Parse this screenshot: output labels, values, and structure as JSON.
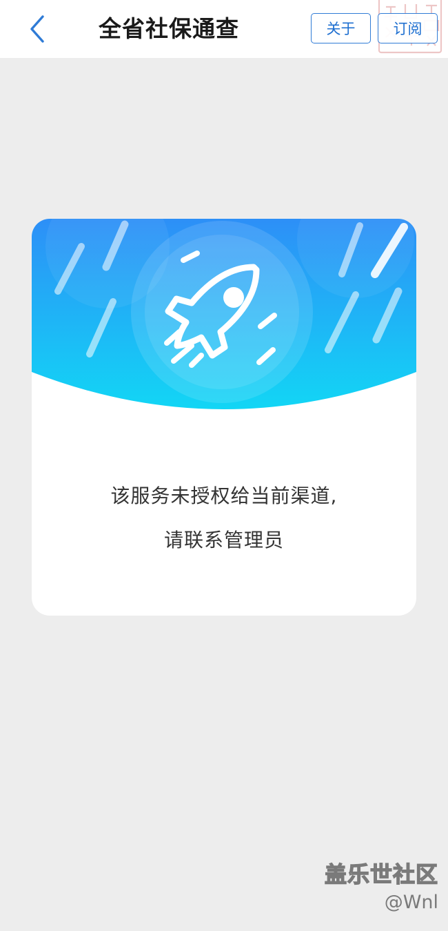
{
  "header": {
    "title": "全省社保通查",
    "about_label": "关于",
    "subscribe_label": "订阅",
    "back_icon": "chevron-left-icon"
  },
  "card": {
    "message_line1": "该服务未授权给当前渠道,",
    "message_line2": "请联系管理员",
    "illustration_icon": "rocket-icon"
  },
  "watermark": {
    "brand": "盖乐世社区",
    "user": "@Wnl"
  },
  "colors": {
    "accent": "#2f7bd6",
    "banner_top": "#2d8ff7",
    "banner_bottom": "#12d6f5",
    "page_background": "#ededed"
  }
}
